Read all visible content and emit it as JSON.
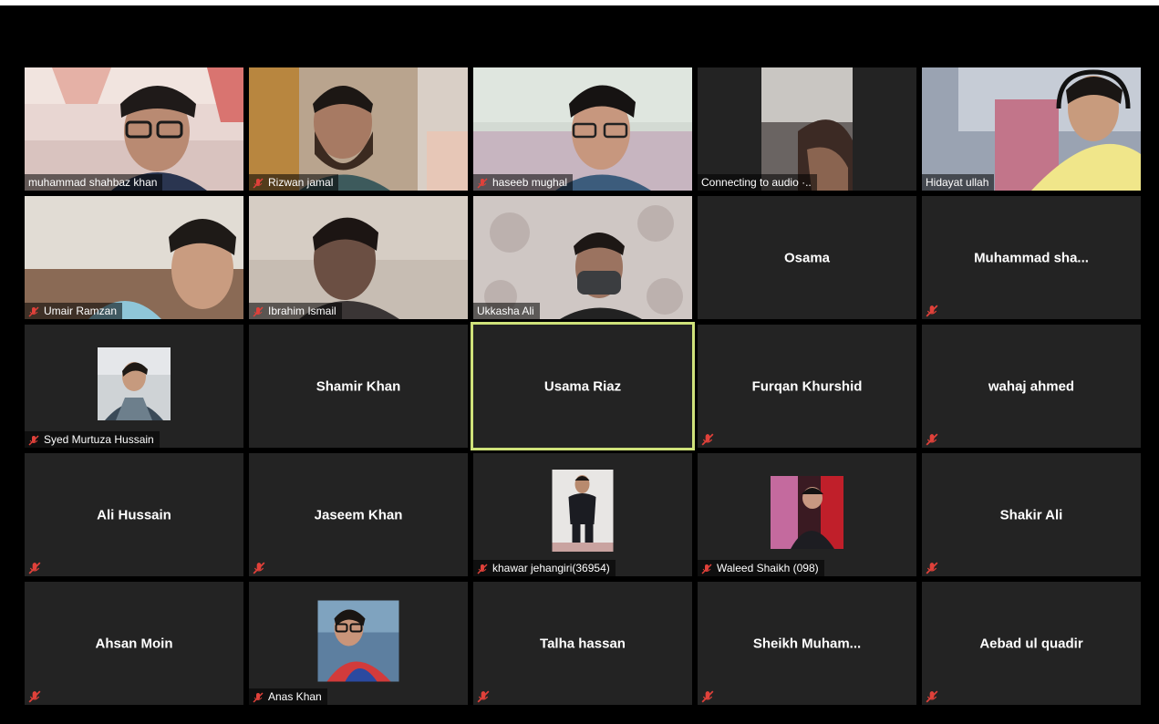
{
  "participants": [
    {
      "name": "muhammad shahbaz khan",
      "video": true,
      "muted": false
    },
    {
      "name": "Rizwan jamal",
      "video": true,
      "muted": true
    },
    {
      "name": "haseeb mughal",
      "video": true,
      "muted": true
    },
    {
      "name": "Connecting to audio ·..",
      "video": true,
      "muted": false
    },
    {
      "name": "Hidayat ullah",
      "video": true,
      "muted": false
    },
    {
      "name": "Umair Ramzan",
      "video": true,
      "muted": true
    },
    {
      "name": "Ibrahim Ismail",
      "video": true,
      "muted": true
    },
    {
      "name": "Ukkasha Ali",
      "video": true,
      "muted": false
    },
    {
      "name": "Osama",
      "video": false,
      "muted": false
    },
    {
      "name": "Muhammad  sha...",
      "video": false,
      "muted": true
    },
    {
      "name": "Syed Murtuza Hussain",
      "video": false,
      "avatar": true,
      "muted": true
    },
    {
      "name": "Shamir Khan",
      "video": false,
      "muted": false
    },
    {
      "name": "Usama Riaz",
      "video": false,
      "muted": false,
      "active_speaker": true
    },
    {
      "name": "Furqan Khurshid",
      "video": false,
      "muted": true
    },
    {
      "name": "wahaj ahmed",
      "video": false,
      "muted": true
    },
    {
      "name": "Ali Hussain",
      "video": false,
      "muted": true
    },
    {
      "name": "Jaseem Khan",
      "video": false,
      "muted": true
    },
    {
      "name": "khawar jehangiri(36954)",
      "video": false,
      "avatar": true,
      "muted": true
    },
    {
      "name": "Waleed Shaikh (098)",
      "video": false,
      "avatar": true,
      "muted": true
    },
    {
      "name": "Shakir Ali",
      "video": false,
      "muted": true
    },
    {
      "name": "Ahsan Moin",
      "video": false,
      "muted": true
    },
    {
      "name": "Anas Khan",
      "video": false,
      "avatar": true,
      "muted": true
    },
    {
      "name": "Talha hassan",
      "video": false,
      "muted": true
    },
    {
      "name": "Sheikh  Muham...",
      "video": false,
      "muted": true
    },
    {
      "name": "Aebad ul quadir",
      "video": false,
      "muted": true
    }
  ],
  "colors": {
    "background": "#000000",
    "tile": "#232323",
    "active_border": "#cfe27a",
    "muted_icon": "#e0413a"
  }
}
